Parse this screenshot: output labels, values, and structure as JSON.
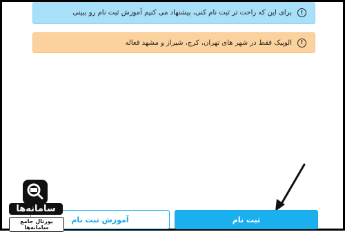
{
  "alerts": [
    {
      "type": "info",
      "icon": "info-icon",
      "text": "برای این که راحت تر ثبت نام کنی، پیشنهاد می کنیم آموزش ثبت نام رو ببینی"
    },
    {
      "type": "warning",
      "icon": "info-icon",
      "text": "الوپیک فقط در شهر های تهران، کرج، شیراز و مشهد فعاله"
    }
  ],
  "buttons": {
    "register_label": "ثبت نام",
    "tutorial_label": "آموزش ثبت نام"
  },
  "watermark": {
    "name": "سامانه‌ها",
    "subtitle": "پورتال جامع سامانه‌ها"
  },
  "colors": {
    "info_bg": "#a8dff9",
    "warning_bg": "#fbd29e",
    "primary": "#1ab0ef"
  }
}
